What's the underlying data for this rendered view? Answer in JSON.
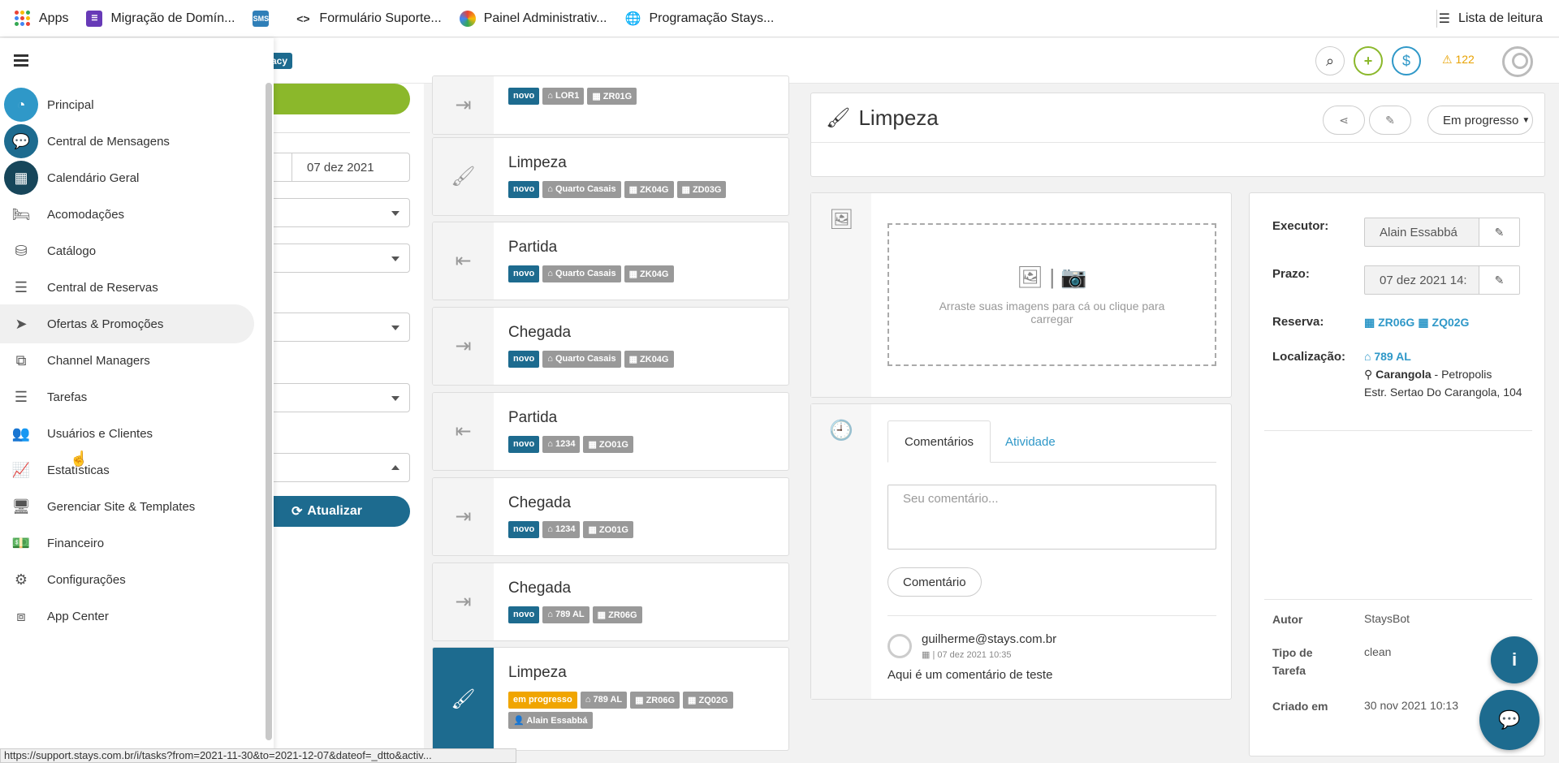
{
  "bookmarks": {
    "items": [
      {
        "label": "Apps",
        "icon": "apps-grid-icon"
      },
      {
        "label": "Migração de Domín...",
        "icon": "form-icon"
      },
      {
        "label": "",
        "icon": "sms-icon",
        "icon_text": "SMS"
      },
      {
        "label": "Formulário Suporte...",
        "icon": "code-icon"
      },
      {
        "label": "Painel Administrativ...",
        "icon": "colorful-icon"
      },
      {
        "label": "Programação Stays...",
        "icon": "globe-icon"
      }
    ],
    "reading_list": "Lista de leitura"
  },
  "header": {
    "brand_badge": "acy",
    "alerts_count": "122"
  },
  "sidebar": {
    "items": [
      {
        "label": "Principal",
        "icon": "dashboard-icon"
      },
      {
        "label": "Central de Mensagens",
        "icon": "chat-icon"
      },
      {
        "label": "Calendário Geral",
        "icon": "calendar-icon"
      },
      {
        "label": "Acomodações",
        "icon": "bed-icon"
      },
      {
        "label": "Catálogo",
        "icon": "database-icon"
      },
      {
        "label": "Central de Reservas",
        "icon": "list-icon"
      },
      {
        "label": "Ofertas & Promoções",
        "icon": "paper-plane-icon"
      },
      {
        "label": "Channel Managers",
        "icon": "sitemap-icon"
      },
      {
        "label": "Tarefas",
        "icon": "tasks-icon"
      },
      {
        "label": "Usuários e Clientes",
        "icon": "users-icon"
      },
      {
        "label": "Estatísticas",
        "icon": "chart-line-icon"
      },
      {
        "label": "Gerenciar Site & Templates",
        "icon": "desktop-icon"
      },
      {
        "label": "Financeiro",
        "icon": "money-icon"
      },
      {
        "label": "Configurações",
        "icon": "gear-icon"
      },
      {
        "label": "App Center",
        "icon": "cubes-icon"
      }
    ]
  },
  "filters": {
    "date_to": "07 dez 2021",
    "refresh_label": "Atualizar"
  },
  "tasks": [
    {
      "title": "",
      "icon": "sign-in-icon",
      "tags": [
        {
          "t": "novo",
          "k": "novo"
        },
        {
          "t": "LOR1",
          "k": "home"
        },
        {
          "t": "ZR01G",
          "k": "cal"
        }
      ]
    },
    {
      "title": "Limpeza",
      "icon": "brush-icon",
      "tags": [
        {
          "t": "novo",
          "k": "novo"
        },
        {
          "t": "Quarto Casais",
          "k": "home"
        },
        {
          "t": "ZK04G",
          "k": "cal"
        },
        {
          "t": "ZD03G",
          "k": "cal"
        }
      ]
    },
    {
      "title": "Partida",
      "icon": "sign-out-icon",
      "tags": [
        {
          "t": "novo",
          "k": "novo"
        },
        {
          "t": "Quarto Casais",
          "k": "home"
        },
        {
          "t": "ZK04G",
          "k": "cal"
        }
      ]
    },
    {
      "title": "Chegada",
      "icon": "sign-in-icon",
      "tags": [
        {
          "t": "novo",
          "k": "novo"
        },
        {
          "t": "Quarto Casais",
          "k": "home"
        },
        {
          "t": "ZK04G",
          "k": "cal"
        }
      ]
    },
    {
      "title": "Partida",
      "icon": "sign-out-icon",
      "tags": [
        {
          "t": "novo",
          "k": "novo"
        },
        {
          "t": "1234",
          "k": "home"
        },
        {
          "t": "ZO01G",
          "k": "cal"
        }
      ]
    },
    {
      "title": "Chegada",
      "icon": "sign-in-icon",
      "tags": [
        {
          "t": "novo",
          "k": "novo"
        },
        {
          "t": "1234",
          "k": "home"
        },
        {
          "t": "ZO01G",
          "k": "cal"
        }
      ]
    },
    {
      "title": "Chegada",
      "icon": "sign-in-icon",
      "tags": [
        {
          "t": "novo",
          "k": "novo"
        },
        {
          "t": "789 AL",
          "k": "home"
        },
        {
          "t": "ZR06G",
          "k": "cal"
        }
      ]
    },
    {
      "title": "Limpeza",
      "icon": "brush-icon",
      "active": true,
      "tags": [
        {
          "t": "em progresso",
          "k": "prog"
        },
        {
          "t": "789 AL",
          "k": "home"
        },
        {
          "t": "ZR06G",
          "k": "cal"
        },
        {
          "t": "ZQ02G",
          "k": "cal"
        },
        {
          "t": "Alain Essabbá",
          "k": "user"
        }
      ]
    }
  ],
  "detail": {
    "title": "Limpeza",
    "status": "Em progresso",
    "dropzone_text": "Arraste suas imagens para cá ou clique para carregar",
    "tab_comments": "Comentários",
    "tab_activity": "Atividade",
    "comment_placeholder": "Seu comentário...",
    "comment_button": "Comentário",
    "comment": {
      "user": "guilherme@stays.com.br",
      "date": "| 07 dez 2021 10:35",
      "text": "Aqui é um comentário de teste"
    }
  },
  "info": {
    "executor_label": "Executor:",
    "executor_value": "Alain Essabbá",
    "deadline_label": "Prazo:",
    "deadline_value": "07 dez 2021 14:",
    "reservation_label": "Reserva:",
    "reservation_1": "ZR06G",
    "reservation_2": "ZQ02G",
    "location_label": "Localização:",
    "location_unit": "789 AL",
    "location_city": "Carangola",
    "location_region": " - Petropolis",
    "location_address": "Estr. Sertao Do Carangola, 104",
    "author_label": "Autor",
    "author_value": "StaysBot",
    "type_label": "Tipo de Tarefa",
    "type_value": "clean",
    "created_label": "Criado em",
    "created_value": "30 nov 2021 10:13"
  },
  "statusbar": {
    "url": "https://support.stays.com.br/i/tasks?from=2021-11-30&to=2021-12-07&dateof=_dtto&activ..."
  },
  "colors": {
    "primary": "#1d6b8f",
    "accent_blue": "#2f98c8",
    "green": "#8bb82b",
    "warning": "#f0a500"
  }
}
